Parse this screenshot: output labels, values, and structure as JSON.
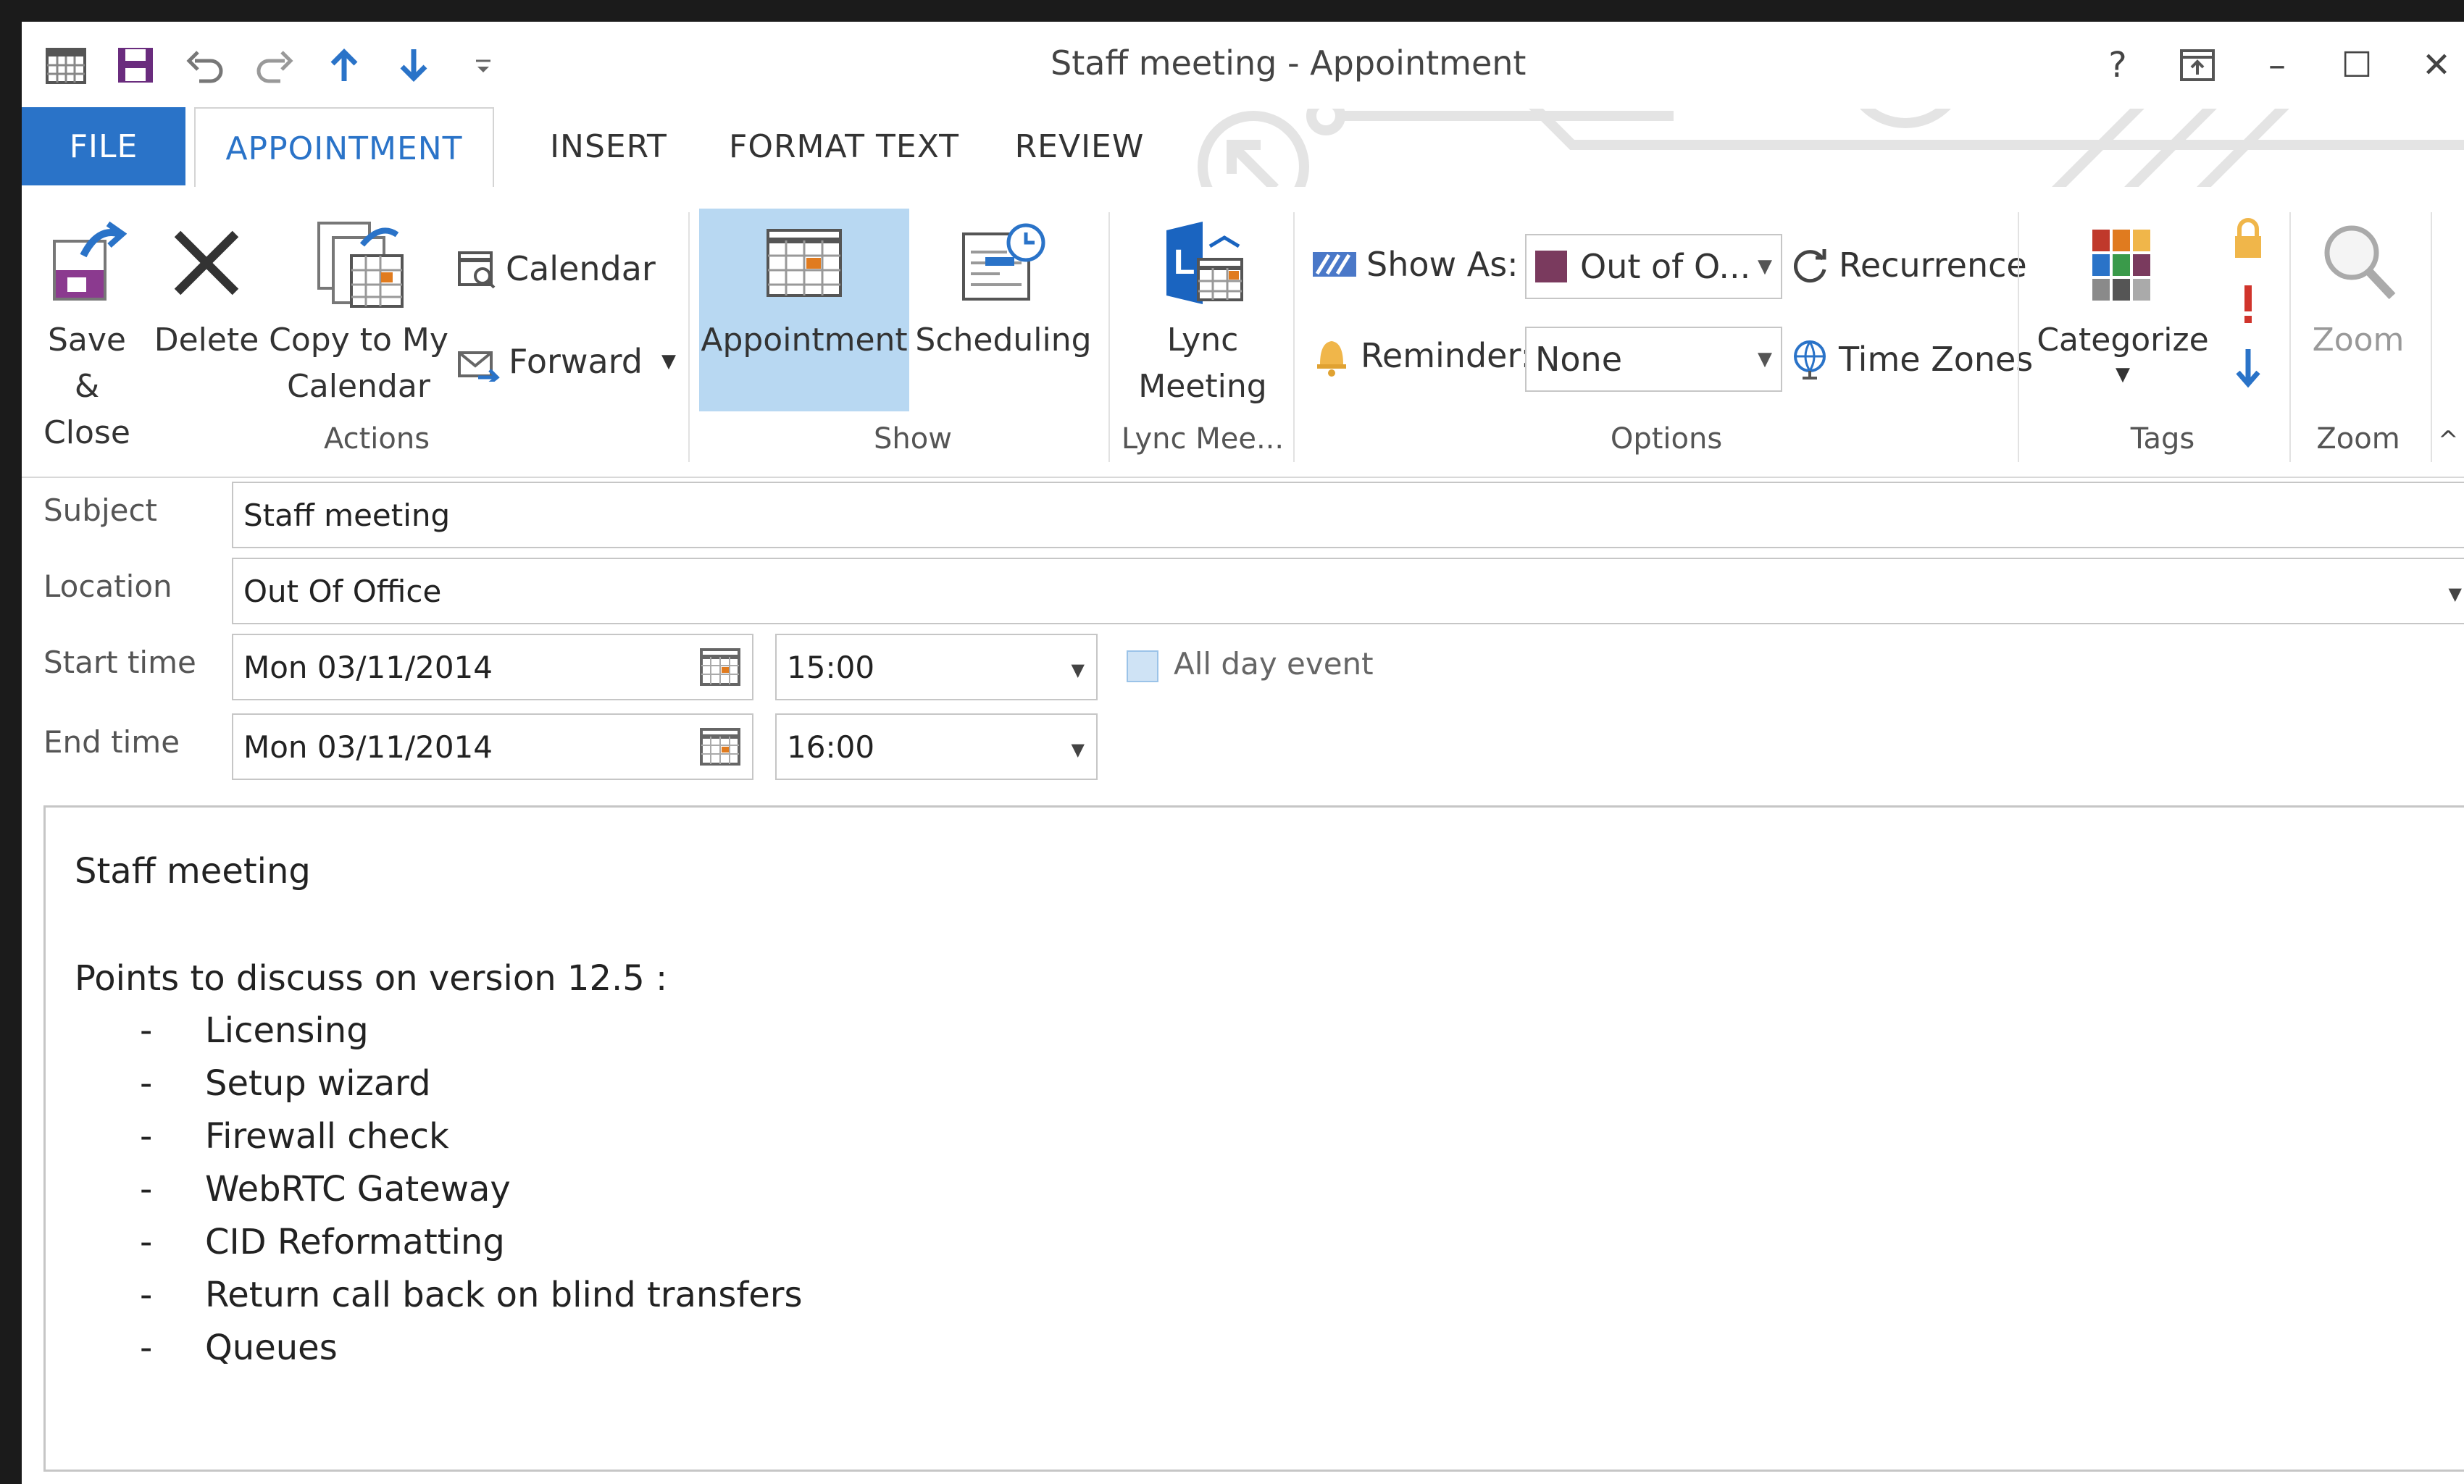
{
  "window": {
    "title": "Staff meeting - Appointment",
    "help": "?",
    "minimize": "–",
    "maximize": "☐",
    "close": "✕"
  },
  "tabs": [
    "FILE",
    "APPOINTMENT",
    "INSERT",
    "FORMAT TEXT",
    "REVIEW"
  ],
  "ribbon": {
    "actions": {
      "label": "Actions",
      "save_close_1": "Save &",
      "save_close_2": "Close",
      "delete": "Delete",
      "copy_1": "Copy to My",
      "copy_2": "Calendar",
      "calendar": "Calendar",
      "forward": "Forward"
    },
    "show": {
      "label": "Show",
      "appointment": "Appointment",
      "scheduling": "Scheduling"
    },
    "lync": {
      "label": "Lync Mee...",
      "lync_1": "Lync",
      "lync_2": "Meeting"
    },
    "options": {
      "label": "Options",
      "show_as": "Show As:",
      "show_as_value": "Out of O...",
      "recurrence": "Recurrence",
      "reminder": "Reminder:",
      "reminder_value": "None",
      "time_zones": "Time Zones"
    },
    "tags": {
      "label": "Tags",
      "categorize": "Categorize"
    },
    "zoom": {
      "label": "Zoom",
      "zoom": "Zoom"
    }
  },
  "form": {
    "subject_label": "Subject",
    "subject_value": "Staff meeting",
    "location_label": "Location",
    "location_value": "Out Of Office",
    "start_label": "Start time",
    "start_date": "Mon 03/11/2014",
    "start_time": "15:00",
    "end_label": "End time",
    "end_date": "Mon 03/11/2014",
    "end_time": "16:00",
    "all_day": "All day event"
  },
  "notes": {
    "title": "Staff meeting",
    "intro": "Points to discuss on version 12.5 :",
    "items": [
      "Licensing",
      "Setup wizard",
      "Firewall check",
      "WebRTC Gateway",
      "CID Reformatting",
      "Return call back on blind transfers",
      "Queues"
    ],
    "dash": "-"
  },
  "colors": {
    "accent": "#2a73c8",
    "selected": "#b8d8f2",
    "out_of_office": "#7a3a5e"
  }
}
